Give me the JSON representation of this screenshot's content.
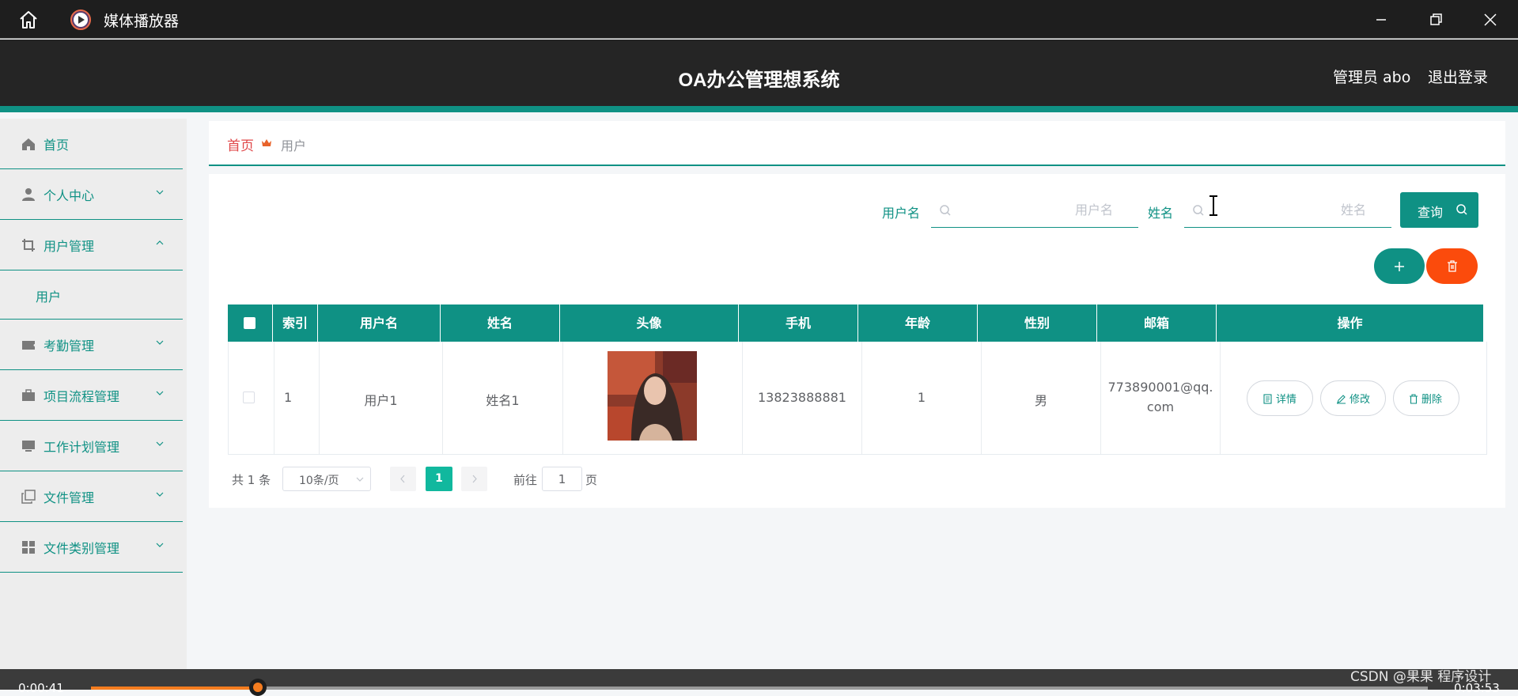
{
  "window": {
    "title": "媒体播放器"
  },
  "header": {
    "title": "OA办公管理想系统",
    "user": "管理员 abo",
    "logout": "退出登录"
  },
  "sidebar": {
    "items": [
      {
        "label": "首页",
        "icon": "home-icon"
      },
      {
        "label": "个人中心",
        "icon": "user-icon"
      },
      {
        "label": "用户管理",
        "icon": "crop-icon"
      },
      {
        "label": "考勤管理",
        "icon": "ticket-icon"
      },
      {
        "label": "项目流程管理",
        "icon": "briefcase-icon"
      },
      {
        "label": "工作计划管理",
        "icon": "monitor-icon"
      },
      {
        "label": "文件管理",
        "icon": "copy-icon"
      },
      {
        "label": "文件类别管理",
        "icon": "grid-icon"
      }
    ],
    "sub_items": [
      {
        "label": "用户"
      }
    ]
  },
  "breadcrumb": {
    "home": "首页",
    "current": "用户"
  },
  "search": {
    "username_label": "用户名",
    "username_placeholder": "用户名",
    "name_label": "姓名",
    "name_placeholder": "姓名",
    "query_button": "查询"
  },
  "table": {
    "columns": [
      "索引",
      "用户名",
      "姓名",
      "头像",
      "手机",
      "年龄",
      "性别",
      "邮箱",
      "操作"
    ],
    "rows": [
      {
        "index": "1",
        "username": "用户1",
        "name": "姓名1",
        "phone": "13823888881",
        "age": "1",
        "gender": "男",
        "email_line1": "773890001@qq.",
        "email_line2": "com"
      }
    ],
    "actions": {
      "detail": "详情",
      "edit": "修改",
      "delete": "删除"
    }
  },
  "pagination": {
    "total": "共 1 条",
    "page_size": "10条/页",
    "current_page": "1",
    "goto_label": "前往",
    "goto_value": "1",
    "page_suffix": "页"
  },
  "player": {
    "elapsed": "0:00:41",
    "remaining": "0:03:53",
    "progress": 0.125
  },
  "watermark": "CSDN @果果 程序设计",
  "colors": {
    "accent": "#0f9184",
    "danger": "#fb4b0c",
    "breadcrumb_home": "#e0484a",
    "active_page": "#11b89e"
  }
}
